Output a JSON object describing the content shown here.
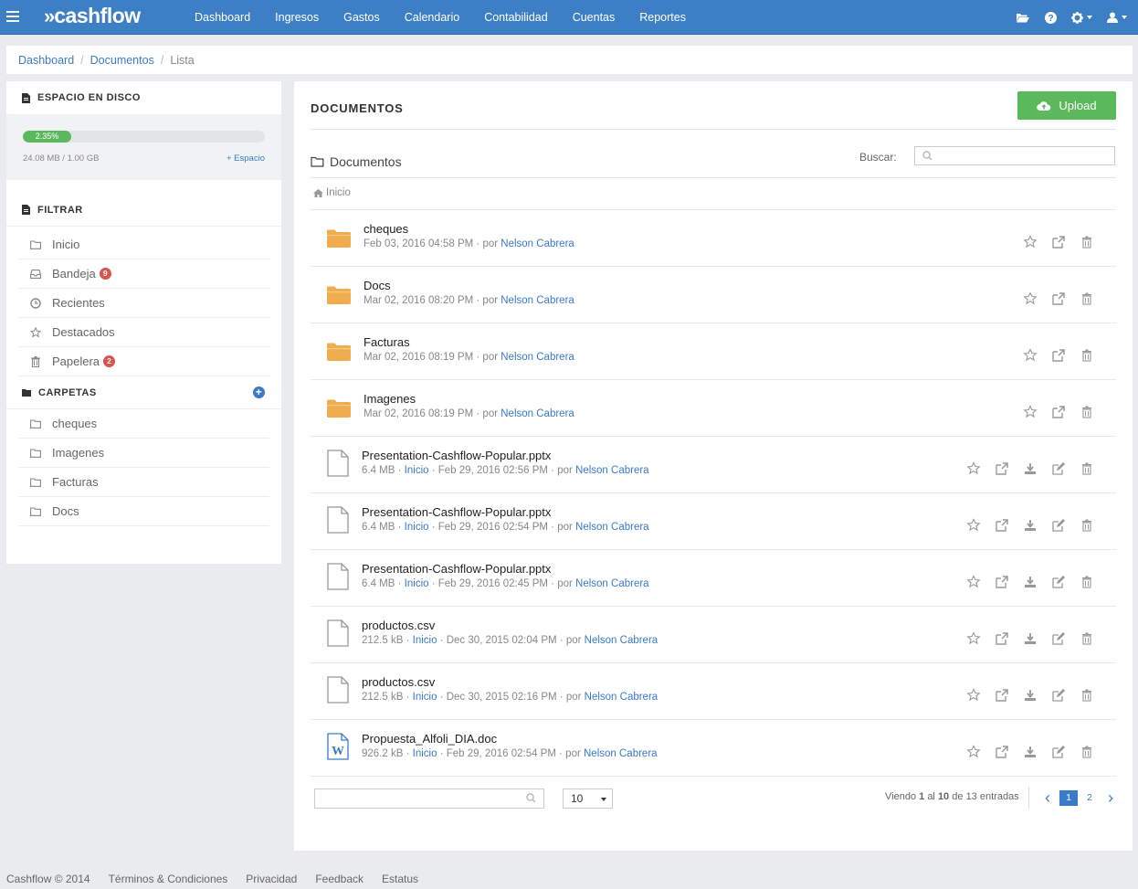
{
  "brand": {
    "name": "cashflow",
    "mark": "»",
    "accent": "#3d7fc4"
  },
  "nav": {
    "items": [
      "Dashboard",
      "Ingresos",
      "Gastos",
      "Calendario",
      "Contabilidad",
      "Cuentas",
      "Reportes"
    ],
    "right_icons": [
      "folder-open-icon",
      "help-icon",
      "settings-icon",
      "user-icon"
    ]
  },
  "breadcrumb": {
    "items": [
      "Dashboard",
      "Documentos"
    ],
    "current": "Lista"
  },
  "sidebar": {
    "disk": {
      "title": "ESPACIO EN DISCO",
      "percent_label": "2.35%",
      "percent": 2.35,
      "usage": "24.08 MB / 1.00 GB",
      "more_label": "+ Espacio"
    },
    "filter": {
      "title": "FILTRAR",
      "items": [
        {
          "label": "Inicio",
          "icon": "folder-icon",
          "badge": ""
        },
        {
          "label": "Bandeja",
          "icon": "inbox-icon",
          "badge": "9"
        },
        {
          "label": "Recientes",
          "icon": "clock-icon",
          "badge": ""
        },
        {
          "label": "Destacados",
          "icon": "star-icon",
          "badge": ""
        },
        {
          "label": "Papelera",
          "icon": "trash-icon",
          "badge": "2"
        }
      ]
    },
    "folders": {
      "title": "CARPETAS",
      "items": [
        "cheques",
        "Imagenes",
        "Facturas",
        "Docs"
      ]
    }
  },
  "main": {
    "title": "DOCUMENTOS",
    "upload_label": "Upload",
    "folder_title": "Documentos",
    "search_label": "Buscar:",
    "path": "Inicio",
    "rows": [
      {
        "type": "folder",
        "name": "cheques",
        "date": "Feb 03, 2016 04:58 PM",
        "by": "por",
        "author": "Nelson Cabrera"
      },
      {
        "type": "folder",
        "name": "Docs",
        "date": "Mar 02, 2016 08:20 PM",
        "by": "por",
        "author": "Nelson Cabrera"
      },
      {
        "type": "folder",
        "name": "Facturas",
        "date": "Mar 02, 2016 08:19 PM",
        "by": "por",
        "author": "Nelson Cabrera"
      },
      {
        "type": "folder",
        "name": "Imagenes",
        "date": "Mar 02, 2016 08:19 PM",
        "by": "por",
        "author": "Nelson Cabrera"
      },
      {
        "type": "file",
        "name": "Presentation-Cashflow-Popular.pptx",
        "size": "6.4 MB",
        "location": "Inicio",
        "date": "Feb 29, 2016 02:56 PM",
        "by": "por",
        "author": "Nelson Cabrera"
      },
      {
        "type": "file",
        "name": "Presentation-Cashflow-Popular.pptx",
        "size": "6.4 MB",
        "location": "Inicio",
        "date": "Feb 29, 2016 02:54 PM",
        "by": "por",
        "author": "Nelson Cabrera"
      },
      {
        "type": "file",
        "name": "Presentation-Cashflow-Popular.pptx",
        "size": "6.4 MB",
        "location": "Inicio",
        "date": "Feb 29, 2016 02:45 PM",
        "by": "por",
        "author": "Nelson Cabrera"
      },
      {
        "type": "file",
        "name": "productos.csv",
        "size": "212.5 kB",
        "location": "Inicio",
        "date": "Dec 30, 2015 02:04 PM",
        "by": "por",
        "author": "Nelson Cabrera"
      },
      {
        "type": "file",
        "name": "productos.csv",
        "size": "212.5 kB",
        "location": "Inicio",
        "date": "Dec 30, 2015 02:16 PM",
        "by": "por",
        "author": "Nelson Cabrera"
      },
      {
        "type": "word",
        "name": "Propuesta_Alfoli_DIA.doc",
        "size": "926.2 kB",
        "location": "Inicio",
        "date": "Feb 29, 2016 02:54 PM",
        "by": "por",
        "author": "Nelson Cabrera"
      }
    ],
    "page_size": "10",
    "pageinfo": {
      "pre": "Viendo",
      "from": "1",
      "al": "al",
      "to": "10",
      "de": "de",
      "total": "13",
      "post": "entradas"
    },
    "pages": [
      "1",
      "2"
    ],
    "current_page": "1"
  },
  "footer": {
    "items": [
      "Cashflow © 2014",
      "Términos & Condiciones",
      "Privacidad",
      "Feedback",
      "Estatus"
    ]
  },
  "colors": {
    "folder": "#f0ad4e",
    "success": "#5cb85c",
    "danger": "#d9534f",
    "link": "#3a7bc8"
  }
}
